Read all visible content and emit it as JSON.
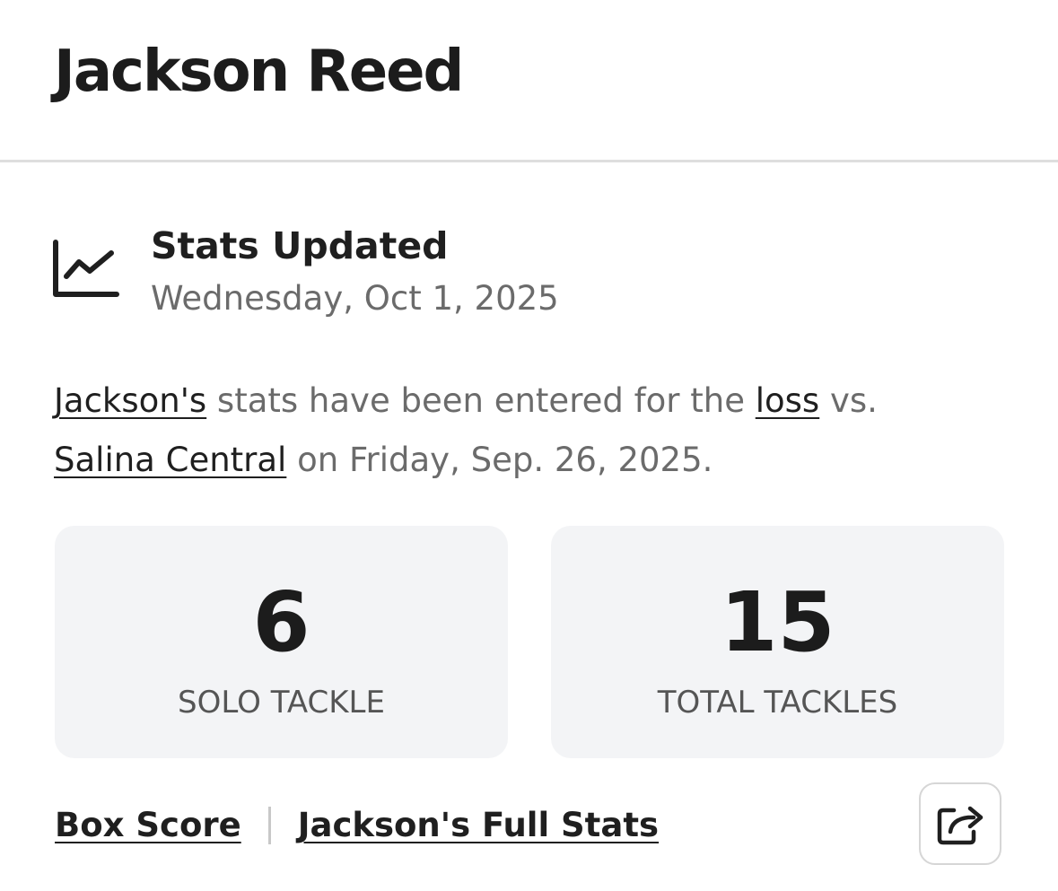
{
  "header": {
    "player_name": "Jackson Reed"
  },
  "update": {
    "icon": "line-chart-icon",
    "title": "Stats Updated",
    "date": "Wednesday, Oct 1, 2025"
  },
  "summary": {
    "player_link": "Jackson's",
    "text_1": " stats have been entered for the ",
    "result_link": "loss",
    "text_2": " vs. ",
    "opponent_link": "Salina Central",
    "text_3": " on Friday, Sep. 26, 2025."
  },
  "stats": [
    {
      "value": "6",
      "label": "SOLO TACKLE"
    },
    {
      "value": "15",
      "label": "TOTAL TACKLES"
    }
  ],
  "footer": {
    "box_score_label": "Box Score",
    "full_stats_label": "Jackson's Full Stats",
    "share_icon": "share-icon"
  },
  "colors": {
    "text_primary": "#1f1f1f",
    "text_secondary": "#6b6b6b",
    "card_background": "#f3f4f6",
    "divider": "#dedede"
  }
}
